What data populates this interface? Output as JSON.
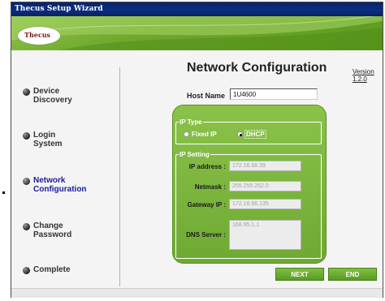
{
  "window": {
    "title": "Thecus Setup Wizard"
  },
  "logo": {
    "text": "Thecus"
  },
  "sidebar": {
    "items": [
      {
        "label": "Device\nDiscovery",
        "active": false
      },
      {
        "label": "Login\nSystem",
        "active": false
      },
      {
        "label": "Network\nConfiguration",
        "active": true
      },
      {
        "label": "Change\nPassword",
        "active": false
      },
      {
        "label": "Complete",
        "active": false
      }
    ]
  },
  "main": {
    "title": "Network Configuration",
    "version_link": "Version 1.2.0",
    "hostname": {
      "label": "Host Name",
      "value": "1U4600"
    },
    "ip_type": {
      "legend": "IP Type",
      "options": [
        {
          "label": "Fixed IP",
          "selected": false
        },
        {
          "label": "DHCP",
          "selected": true
        }
      ]
    },
    "ip_setting": {
      "legend": "IP Setting",
      "ip_address": {
        "label": "IP address :",
        "value": "172.16.66.39"
      },
      "netmask": {
        "label": "Netmask :",
        "value": "255.255.252.0"
      },
      "gateway": {
        "label": "Gateway IP :",
        "value": "172.16.66.135"
      },
      "dns": {
        "label": "DNS Server :",
        "value": "168.95.1.1"
      }
    },
    "buttons": {
      "next": "NEXT",
      "end": "END"
    }
  },
  "colors": {
    "banner_green": "#6ea72c",
    "panel_green": "#7cb93e",
    "titlebar_blue": "#0a246a"
  }
}
